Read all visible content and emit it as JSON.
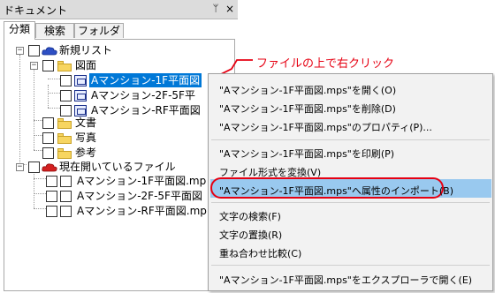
{
  "panel": {
    "title": "ドキュメント",
    "pin_glyph": "ᛘ",
    "close_glyph": "×",
    "tabs": [
      {
        "label": "分類",
        "active": true
      },
      {
        "label": "検索",
        "active": false
      },
      {
        "label": "フォルダ",
        "active": false
      }
    ]
  },
  "tree": {
    "new_list": "新規リスト",
    "drawings": "図面",
    "drawing_items": [
      "Aマンション-1F平面図",
      "Aマンション-2F-5F平",
      "Aマンション-RF平面図"
    ],
    "documents": "文書",
    "photos": "写真",
    "reference": "参考",
    "open_files": "現在開いているファイル",
    "open_items": [
      "Aマンション-1F平面図.mp",
      "Aマンション-2F-5F平面図",
      "Aマンション-RF平面図.mp"
    ]
  },
  "annotation": "ファイルの上で右クリック",
  "context_menu": {
    "items": [
      "\"Aマンション-1F平面図.mps\"を開く(O)",
      "\"Aマンション-1F平面図.mps\"を削除(D)",
      "\"Aマンション-1F平面図.mps\"のプロパティ(P)...",
      "\"Aマンション-1F平面図.mps\"を印刷(P)",
      "ファイル形式を変換(V)",
      "\"Aマンション-1F平面図.mps\"へ属性のインポート(B)",
      "文字の検索(F)",
      "文字の置換(R)",
      "重ね合わせ比較(C)",
      "\"Aマンション-1F平面図.mps\"をエクスプローラで開く(E)"
    ],
    "highlighted_index": 5
  },
  "colors": {
    "selection": "#0078d7",
    "menu_highlight": "#99c9ef",
    "annotation_red": "#e60012",
    "folder_yellow": "#f7d560"
  }
}
